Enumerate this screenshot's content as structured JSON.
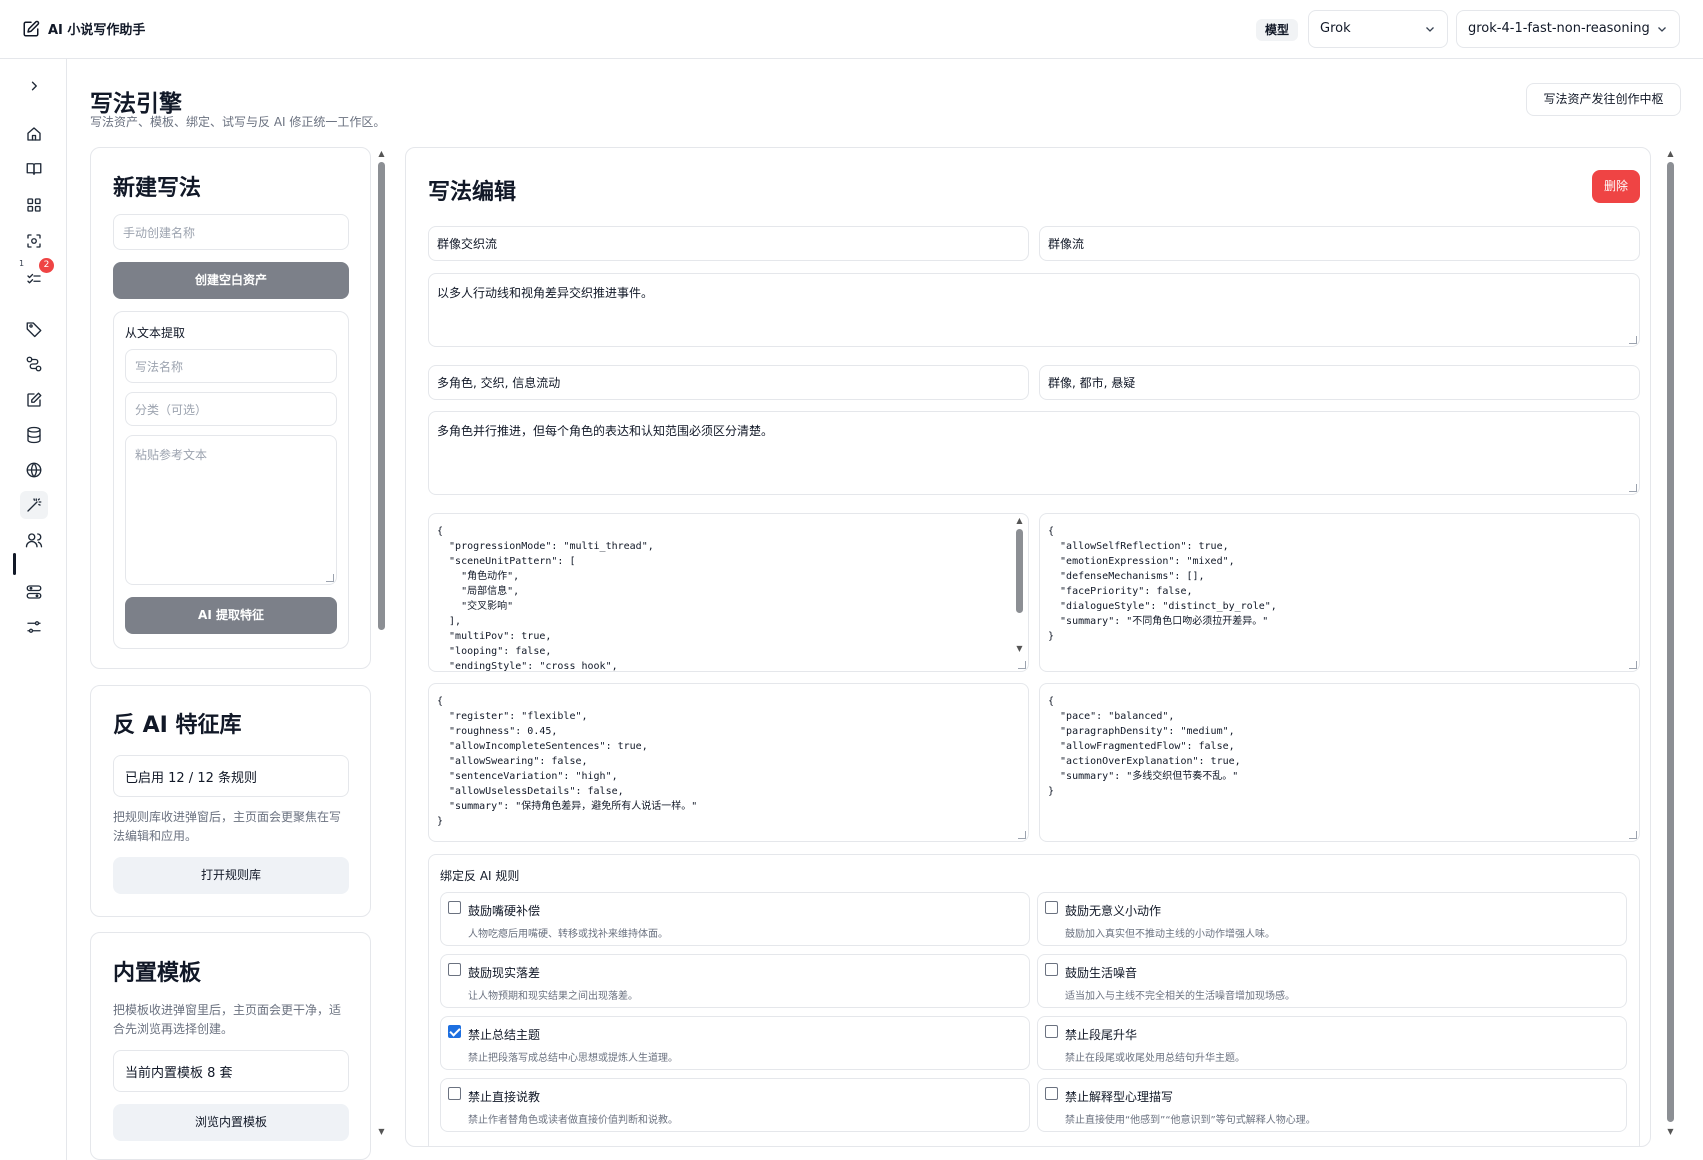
{
  "app": {
    "title": "AI 小说写作助手",
    "model_label": "模型",
    "provider": "Grok",
    "model": "grok-4-1-fast-non-reasoning"
  },
  "sidebar": {
    "items": [
      {
        "icon": "chevron-right-icon"
      },
      {
        "icon": "home-icon"
      },
      {
        "icon": "book-open-icon"
      },
      {
        "icon": "grid-icon"
      },
      {
        "icon": "scan-icon"
      },
      {
        "icon": "tasks-icon",
        "badge": "2",
        "mark": "1"
      },
      {
        "icon": "tag-icon"
      },
      {
        "icon": "workflow-icon"
      },
      {
        "icon": "edit-icon"
      },
      {
        "icon": "database-icon"
      },
      {
        "icon": "globe-icon"
      },
      {
        "icon": "magic-wand-icon",
        "active": true
      },
      {
        "icon": "users-icon"
      },
      {
        "icon": "sliders-icon"
      },
      {
        "icon": "settings-sliders-icon"
      }
    ]
  },
  "page": {
    "title": "写法引擎",
    "subtitle": "写法资产、模板、绑定、试写与反 AI 修正统一工作区。",
    "hub_button": "写法资产发往创作中枢"
  },
  "new_style": {
    "title": "新建写法",
    "name_placeholder": "手动创建名称",
    "create_button": "创建空白资产",
    "extract": {
      "title": "从文本提取",
      "name_placeholder": "写法名称",
      "category_placeholder": "分类（可选）",
      "text_placeholder": "粘贴参考文本",
      "button": "AI 提取特征"
    }
  },
  "anti_ai": {
    "title": "反 AI 特征库",
    "status": "已启用 12 / 12 条规则",
    "desc": "把规则库收进弹窗后，主页面会更聚焦在写法编辑和应用。",
    "button": "打开规则库"
  },
  "templates": {
    "title": "内置模板",
    "desc": "把模板收进弹窗里后，主页面会更干净，适合先浏览再选择创建。",
    "count": "当前内置模板 8 套",
    "button": "浏览内置模板"
  },
  "editor": {
    "title": "写法编辑",
    "delete_button": "删除",
    "name": "群像交织流",
    "category": "群像流",
    "description": "以多人行动线和视角差异交织推进事件。",
    "tags": "多角色, 交织, 信息流动",
    "genres": "群像, 都市, 悬疑",
    "notes": "多角色并行推进，但每个角色的表达和认知范围必须区分清楚。",
    "json_structure": "{\n  \"progressionMode\": \"multi_thread\",\n  \"sceneUnitPattern\": [\n    \"角色动作\",\n    \"局部信息\",\n    \"交叉影响\"\n  ],\n  \"multiPov\": true,\n  \"looping\": false,\n  \"endingStyle\": \"cross_hook\",",
    "json_character": "{\n  \"allowSelfReflection\": true,\n  \"emotionExpression\": \"mixed\",\n  \"defenseMechanisms\": [],\n  \"facePriority\": false,\n  \"dialogueStyle\": \"distinct_by_role\",\n  \"summary\": \"不同角色口吻必须拉开差异。\"\n}",
    "json_language": "{\n  \"register\": \"flexible\",\n  \"roughness\": 0.45,\n  \"allowIncompleteSentences\": true,\n  \"allowSwearing\": false,\n  \"sentenceVariation\": \"high\",\n  \"allowUselessDetails\": false,\n  \"summary\": \"保持角色差异，避免所有人说话一样。\"\n}",
    "json_rhythm": "{\n  \"pace\": \"balanced\",\n  \"paragraphDensity\": \"medium\",\n  \"allowFragmentedFlow\": false,\n  \"actionOverExplanation\": true,\n  \"summary\": \"多线交织但节奏不乱。\"\n}",
    "rules_title": "绑定反 AI 规则",
    "rules": [
      {
        "name": "鼓励嘴硬补偿",
        "desc": "人物吃瘪后用嘴硬、转移或找补来维持体面。",
        "checked": false
      },
      {
        "name": "鼓励无意义小动作",
        "desc": "鼓励加入真实但不推动主线的小动作增强人味。",
        "checked": false
      },
      {
        "name": "鼓励现实落差",
        "desc": "让人物预期和现实结果之间出现落差。",
        "checked": false
      },
      {
        "name": "鼓励生活噪音",
        "desc": "适当加入与主线不完全相关的生活噪音增加现场感。",
        "checked": false
      },
      {
        "name": "禁止总结主题",
        "desc": "禁止把段落写成总结中心思想或提炼人生道理。",
        "checked": true
      },
      {
        "name": "禁止段尾升华",
        "desc": "禁止在段尾或收尾处用总结句升华主题。",
        "checked": false
      },
      {
        "name": "禁止直接说教",
        "desc": "禁止作者替角色或读者做直接价值判断和说教。",
        "checked": false
      },
      {
        "name": "禁止解释型心理描写",
        "desc": "禁止直接使用“他感到”“他意识到”等句式解释人物心理。",
        "checked": false
      }
    ]
  }
}
